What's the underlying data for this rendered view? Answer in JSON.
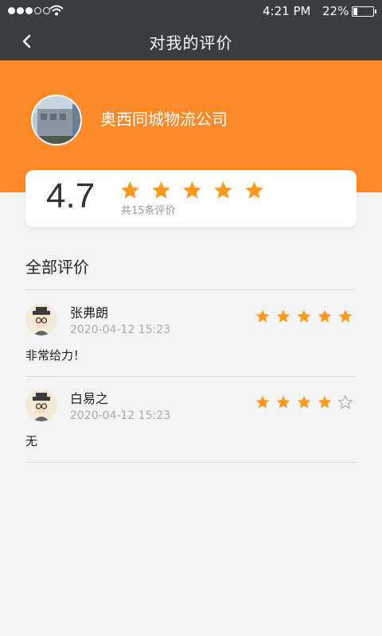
{
  "status_bar": {
    "time": "4:21 PM",
    "battery": "22%",
    "battery_level": 0.22
  },
  "nav": {
    "title": "对我的评价",
    "back_icon": "chevron-left-icon"
  },
  "header": {
    "company_name": "奥西同城物流公司",
    "background_color": "#ff8a2a"
  },
  "summary": {
    "score": "4.7",
    "stars": 5,
    "count_text": "共15条评价",
    "star_color": "#ff9a1f"
  },
  "reviews_section": {
    "title": "全部评价"
  },
  "reviews": [
    {
      "name": "张弗朗",
      "date": "2020-04-12 15:23",
      "rating": 5,
      "text": "非常给力！"
    },
    {
      "name": "白易之",
      "date": "2020-04-12 15:23",
      "rating": 4,
      "text": "无"
    }
  ]
}
